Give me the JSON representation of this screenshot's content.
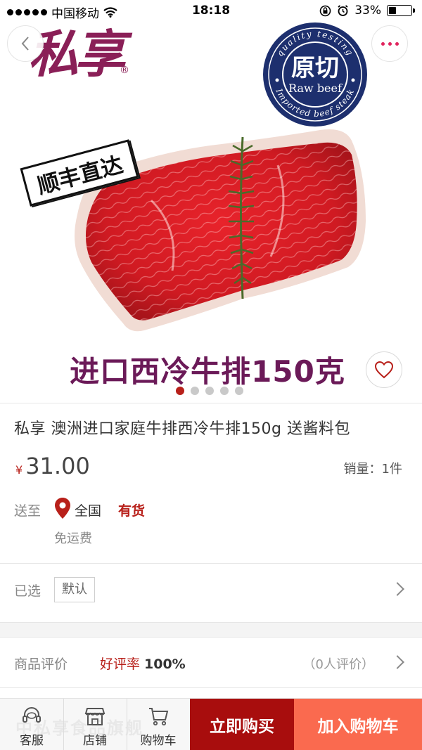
{
  "status_bar": {
    "carrier": "中国移动",
    "time": "18:18",
    "battery": "33%",
    "battery_level": 0.33
  },
  "hero": {
    "brand": "私享",
    "brand_mark": "®",
    "badge_cn": "原切",
    "badge_en": "Raw beef",
    "badge_ring_top": "quality testing",
    "badge_ring_bottom": "Imported beef steak",
    "stamp": "顺丰直达",
    "caption": "进口西冷牛排150克",
    "image_count": 5,
    "active_image": 1
  },
  "product": {
    "title": "私享 澳洲进口家庭牛排西冷牛排150g 送酱料包",
    "currency": "¥",
    "price": "31.00",
    "sales": "销量：1件"
  },
  "shipping": {
    "label": "送至",
    "region": "全国",
    "stock": "有货",
    "freight": "免运费"
  },
  "selection": {
    "label": "已选",
    "value": "默认"
  },
  "reviews": {
    "label": "商品评价",
    "rate_label": "好评率",
    "rate_value": "100%",
    "count": "（0人评价）"
  },
  "bottom_bar": {
    "watermark": "中私享食品旗舰",
    "service": "客服",
    "store": "店铺",
    "cart": "购物车",
    "buy_now": "立即购买",
    "add_to_cart": "加入购物车"
  },
  "colors": {
    "accent_red": "#b8201a",
    "buy_now_bg": "#a80d0d",
    "add_cart_bg": "#fa6a4f",
    "brand_purple": "#8a1f57",
    "badge_navy": "#1d2f6e"
  }
}
